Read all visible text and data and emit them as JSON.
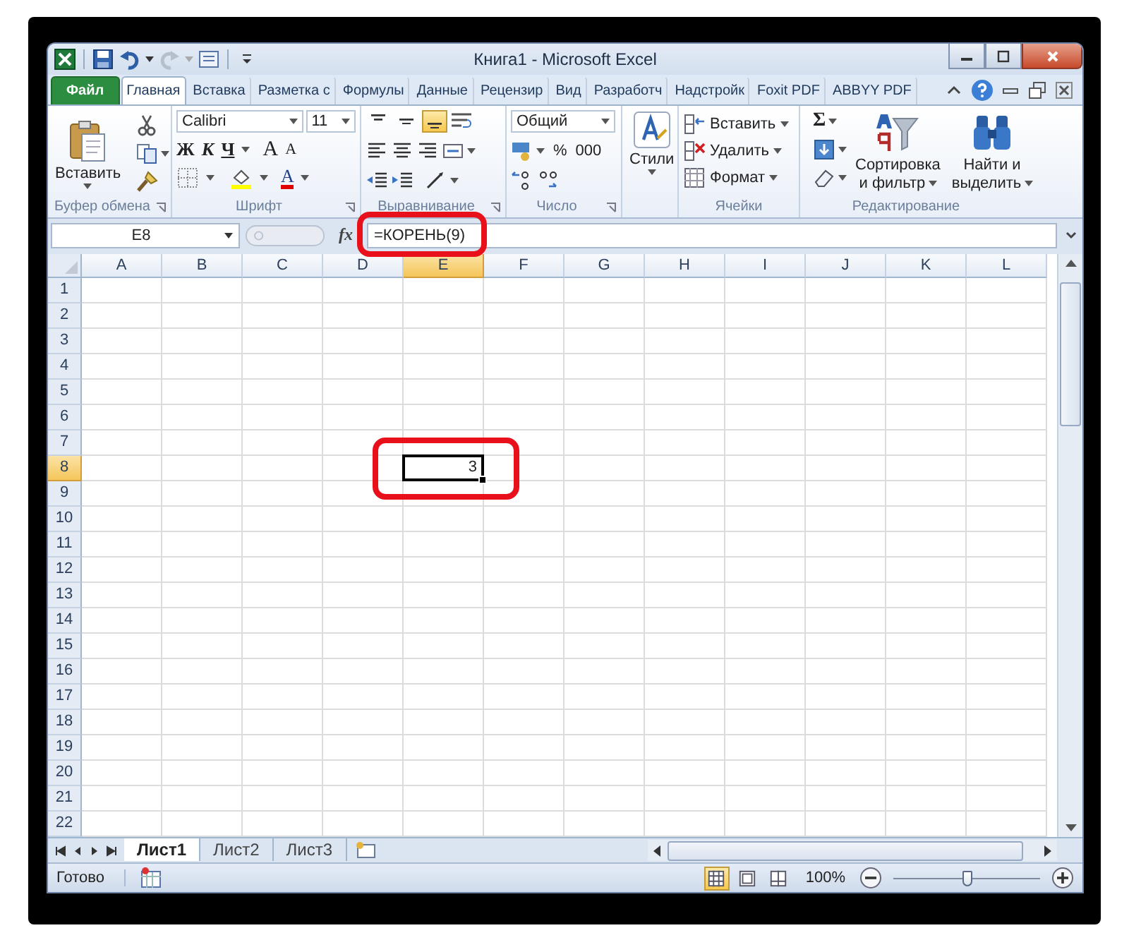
{
  "window": {
    "title": "Книга1 - Microsoft Excel"
  },
  "ribbon_tabs": [
    {
      "label": "Файл",
      "kind": "file",
      "selected": false
    },
    {
      "label": "Главная",
      "kind": "tab",
      "selected": true
    },
    {
      "label": "Вставка",
      "kind": "tab",
      "selected": false
    },
    {
      "label": "Разметка с",
      "kind": "tab",
      "selected": false
    },
    {
      "label": "Формулы",
      "kind": "tab",
      "selected": false
    },
    {
      "label": "Данные",
      "kind": "tab",
      "selected": false
    },
    {
      "label": "Рецензир",
      "kind": "tab",
      "selected": false
    },
    {
      "label": "Вид",
      "kind": "tab",
      "selected": false
    },
    {
      "label": "Разработч",
      "kind": "tab",
      "selected": false
    },
    {
      "label": "Надстройк",
      "kind": "tab",
      "selected": false
    },
    {
      "label": "Foxit PDF",
      "kind": "tab",
      "selected": false
    },
    {
      "label": "ABBYY PDF",
      "kind": "tab",
      "selected": false
    }
  ],
  "ribbon": {
    "groups": [
      {
        "kind": "clipboard",
        "title": "Буфер обмена",
        "paste": "Вставить"
      },
      {
        "kind": "font",
        "title": "Шрифт",
        "font_name": "Calibri",
        "font_size": "11",
        "bold": "Ж",
        "italic": "К",
        "underline": "Ч",
        "grow": "A",
        "shrink": "A",
        "font_color": "A"
      },
      {
        "kind": "alignment",
        "title": "Выравнивание",
        "vertical_align": [
          {
            "selected": false
          },
          {
            "selected": false
          },
          {
            "selected": true
          }
        ]
      },
      {
        "kind": "number",
        "title": "Число",
        "format": "Общий",
        "percent": "%",
        "thousands": "000"
      },
      {
        "kind": "styles",
        "button": "Стили"
      },
      {
        "kind": "cells",
        "title": "Ячейки",
        "insert": "Вставить",
        "delete": "Удалить",
        "format": "Формат"
      },
      {
        "kind": "editing",
        "title": "Редактирование",
        "sum": "Σ",
        "sort": [
          "Сортировка",
          "и фильтр"
        ],
        "find": [
          "Найти и",
          "выделить"
        ]
      }
    ]
  },
  "formula_bar": {
    "name_box": "E8",
    "function_label": "fx",
    "formula": "=КОРЕНЬ(9)",
    "highlighted": true
  },
  "grid": {
    "columns": [
      {
        "label": "A",
        "selected": false
      },
      {
        "label": "B",
        "selected": false
      },
      {
        "label": "C",
        "selected": false
      },
      {
        "label": "D",
        "selected": false
      },
      {
        "label": "E",
        "selected": true
      },
      {
        "label": "F",
        "selected": false
      },
      {
        "label": "G",
        "selected": false
      },
      {
        "label": "H",
        "selected": false
      },
      {
        "label": "I",
        "selected": false
      },
      {
        "label": "J",
        "selected": false
      },
      {
        "label": "K",
        "selected": false
      },
      {
        "label": "L",
        "selected": false
      }
    ],
    "rows": [
      {
        "label": "1",
        "selected": false
      },
      {
        "label": "2",
        "selected": false
      },
      {
        "label": "3",
        "selected": false
      },
      {
        "label": "4",
        "selected": false
      },
      {
        "label": "5",
        "selected": false
      },
      {
        "label": "6",
        "selected": false
      },
      {
        "label": "7",
        "selected": false
      },
      {
        "label": "8",
        "selected": true
      },
      {
        "label": "9",
        "selected": false
      },
      {
        "label": "10",
        "selected": false
      },
      {
        "label": "11",
        "selected": false
      },
      {
        "label": "12",
        "selected": false
      },
      {
        "label": "13",
        "selected": false
      },
      {
        "label": "14",
        "selected": false
      },
      {
        "label": "15",
        "selected": false
      },
      {
        "label": "16",
        "selected": false
      },
      {
        "label": "17",
        "selected": false
      },
      {
        "label": "18",
        "selected": false
      },
      {
        "label": "19",
        "selected": false
      },
      {
        "label": "20",
        "selected": false
      },
      {
        "label": "21",
        "selected": false
      },
      {
        "label": "22",
        "selected": false
      }
    ],
    "active_cell": {
      "value": "3",
      "highlighted": true
    }
  },
  "sheet_tabs": [
    {
      "label": "Лист1",
      "selected": true
    },
    {
      "label": "Лист2",
      "selected": false
    },
    {
      "label": "Лист3",
      "selected": false
    }
  ],
  "status_bar": {
    "status": "Готово",
    "views": [
      {
        "kind": "normal",
        "selected": true
      },
      {
        "kind": "page_layout",
        "selected": false
      },
      {
        "kind": "page_break",
        "selected": false
      }
    ],
    "zoom": "100%",
    "zoom_slider": {
      "level": 0.5
    }
  }
}
